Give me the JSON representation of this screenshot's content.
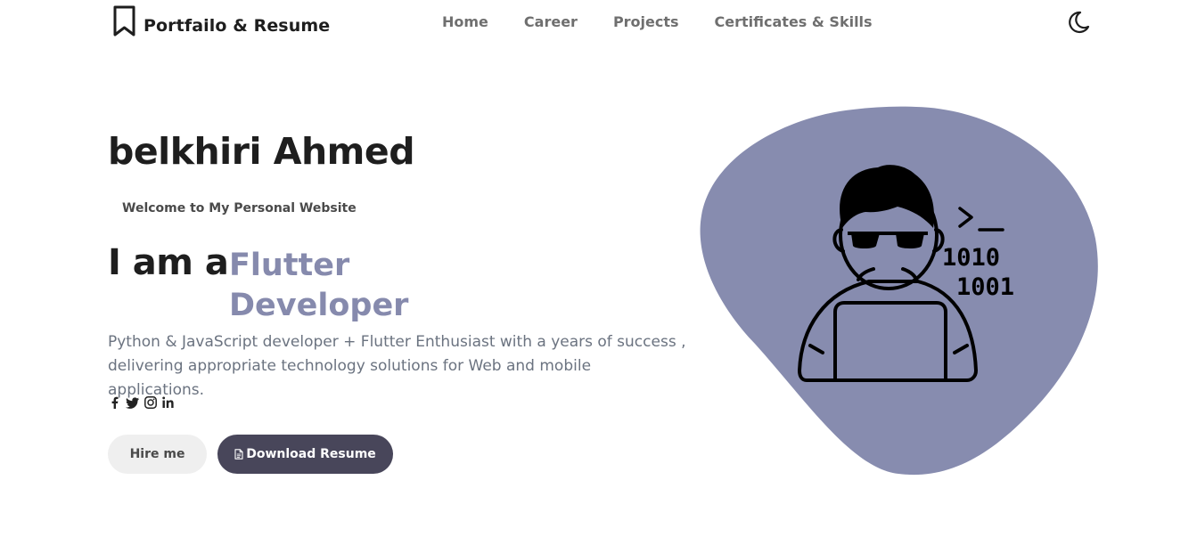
{
  "header": {
    "brand_icon": "bookmark-icon",
    "brand": "Portfailo & Resume",
    "nav": [
      {
        "label": "Home"
      },
      {
        "label": "Career"
      },
      {
        "label": "Projects"
      },
      {
        "label": "Certificates & Skills"
      }
    ],
    "theme_toggle_icon": "moon-icon"
  },
  "hero": {
    "name": "belkhiri Ahmed",
    "welcome": "Welcome to My Personal Website",
    "iam": "I am a",
    "role": "Flutter Developer",
    "description": "Python & JavaScript developer + Flutter Enthusiast with a years of success , delivering appropriate technology solutions for Web and mobile applications.",
    "social_icons": [
      "facebook-icon",
      "twitter-icon",
      "instagram-icon",
      "linkedin-icon"
    ],
    "buttons": {
      "hire": "Hire me",
      "download": "Download Resume",
      "download_icon": "document-icon"
    },
    "illustration": {
      "name": "developer-illustration",
      "prompt": ">_",
      "binary_line_1": "1010",
      "binary_line_2": "1001"
    }
  },
  "colors": {
    "accent": "#868aad",
    "blob": "#878caf",
    "dark_button": "#48465a",
    "light_button": "#efefef",
    "text_dark": "#1e1e1e",
    "text_muted": "#6b7380"
  }
}
